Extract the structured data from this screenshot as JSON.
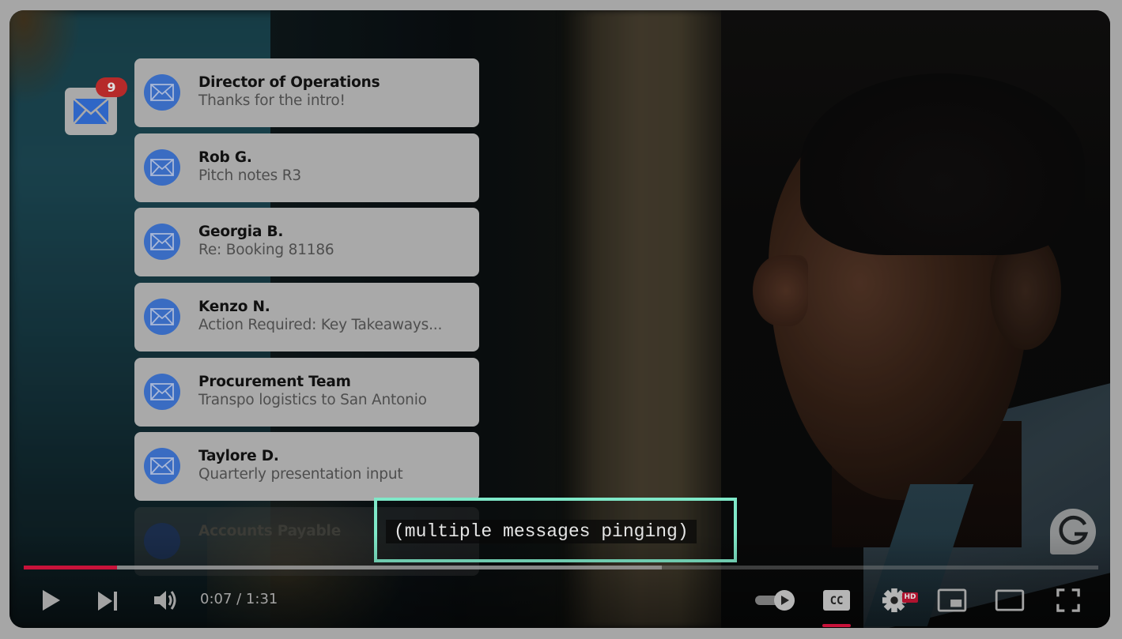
{
  "colors": {
    "accent_red": "#c8123a",
    "caption_border": "#7fe8c8",
    "mail_blue": "#3a6cc2",
    "badge_red": "#b62a2a",
    "card_bg": "#a9a9a9"
  },
  "mail_app": {
    "icon": "mail-envelope-icon",
    "badge_count": "9"
  },
  "notifications": [
    {
      "sender": "Director of Operations",
      "preview": "Thanks for the intro!",
      "icon": "envelope-icon"
    },
    {
      "sender": "Rob G.",
      "preview": "Pitch notes R3",
      "icon": "envelope-icon"
    },
    {
      "sender": "Georgia B.",
      "preview": "Re: Booking 81186",
      "icon": "envelope-icon"
    },
    {
      "sender": "Kenzo N.",
      "preview": "Action Required: Key Takeaways...",
      "icon": "envelope-icon"
    },
    {
      "sender": "Procurement Team",
      "preview": "Transpo logistics to San Antonio",
      "icon": "envelope-icon"
    },
    {
      "sender": "Taylore D.",
      "preview": "Quarterly presentation input",
      "icon": "envelope-icon"
    },
    {
      "sender": "Accounts Payable",
      "preview": "",
      "icon": "envelope-icon",
      "faded": true
    }
  ],
  "caption": {
    "text": "(multiple messages pinging)"
  },
  "watermark": {
    "icon": "g-logo-icon"
  },
  "player": {
    "current_time": "0:07",
    "duration": "1:31",
    "time_display": "0:07 / 1:31",
    "played_fraction": 0.087,
    "buffered_fraction": 0.594,
    "autoplay_on": true,
    "captions_on": true,
    "quality_badge": "HD",
    "controls": {
      "play": "play-icon",
      "next": "next-icon",
      "volume": "volume-icon",
      "autoplay": "autoplay-toggle-icon",
      "captions": "cc-icon",
      "settings": "gear-icon",
      "miniplayer": "miniplayer-icon",
      "theater": "theater-mode-icon",
      "fullscreen": "fullscreen-icon"
    }
  }
}
